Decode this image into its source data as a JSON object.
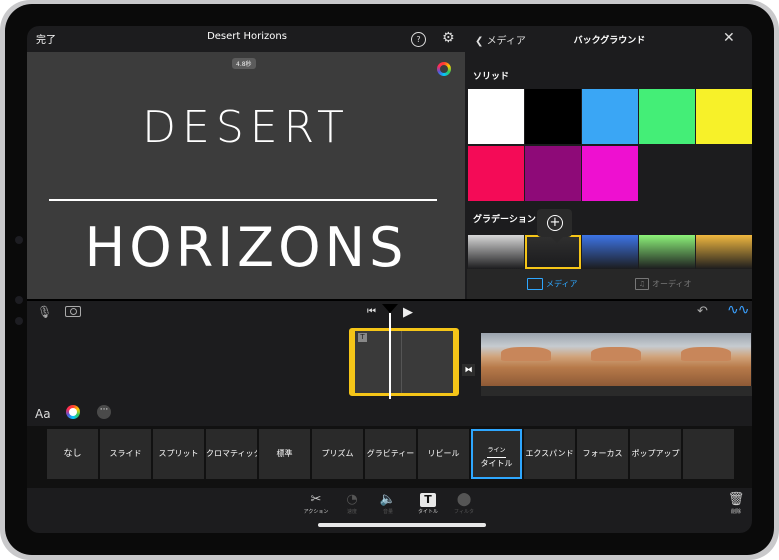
{
  "topbar": {
    "done": "完了",
    "project_title": "Desert Horizons",
    "help": "?"
  },
  "viewer": {
    "duration": "4.8秒",
    "title_line1": "DESERT",
    "title_line2": "HORIZONS"
  },
  "panel": {
    "back": "メディア",
    "title": "バックグラウンド",
    "solid_label": "ソリッド",
    "gradient_label": "グラデーション",
    "solid_colors": [
      "#ffffff",
      "#000000",
      "#3aa6f5",
      "#44ee77",
      "#f7f129",
      "#f40b57",
      "#8e0a78",
      "#ee10d0"
    ],
    "gradient_colors": [
      "#d8d8d8",
      "#2f2f2f",
      "#3d74e6",
      "#8cf279",
      "#f0b840"
    ],
    "tabs": [
      {
        "label": "メディア",
        "active": true
      },
      {
        "label": "オーディオ",
        "active": false
      }
    ]
  },
  "style_bar": {
    "font_label": "Aa"
  },
  "title_styles": [
    {
      "label": "なし"
    },
    {
      "label": "スライド"
    },
    {
      "label": "スプリット"
    },
    {
      "label": "クロマティック"
    },
    {
      "label": "標準"
    },
    {
      "label": "プリズム"
    },
    {
      "label": "グラビティー"
    },
    {
      "label": "リビール"
    },
    {
      "label": "ライン",
      "sublabel": "タイトル",
      "selected": true
    },
    {
      "label": "エクスパンド"
    },
    {
      "label": "フォーカス"
    },
    {
      "label": "ポップアップ"
    },
    {
      "label": ""
    }
  ],
  "toolbar": {
    "items": [
      {
        "label": "アクション",
        "icon": "scissors-icon",
        "active": true
      },
      {
        "label": "速度",
        "icon": "speedometer-icon",
        "active": false
      },
      {
        "label": "音量",
        "icon": "speaker-icon",
        "active": false
      },
      {
        "label": "タイトル",
        "icon": "title-icon",
        "active": true
      },
      {
        "label": "フィルタ",
        "icon": "filter-icon",
        "active": false
      }
    ],
    "delete_label": "削除"
  },
  "colors": {
    "accent": "#2ea7ff",
    "selection": "#f5c518",
    "waveform": "#3aa0ff"
  }
}
